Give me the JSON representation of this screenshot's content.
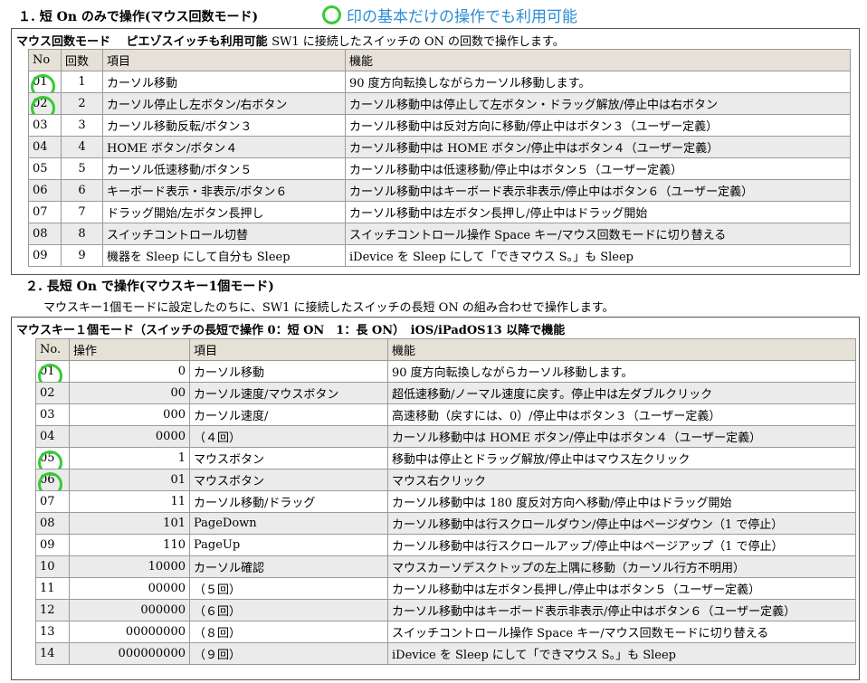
{
  "section1": {
    "title": "１. 短 On のみで操作(マウス回数モード)",
    "note": "印の基本だけの操作でも利用可能",
    "header_bold": "マウス回数モード　 ピエゾスイッチも利用可能",
    "header_plain": "SW1 に接続したスイッチの ON の回数で操作します。",
    "columns": [
      "No",
      "回数",
      "項目",
      "機能"
    ],
    "rows": [
      {
        "no": "01",
        "count": "1",
        "item": "カーソル移動",
        "func": "90 度方向転換しながらカーソル移動します。",
        "highlight": true
      },
      {
        "no": "02",
        "count": "2",
        "item": "カーソル停止し左ボタン/右ボタン",
        "func": "カーソル移動中は停止して左ボタン・ドラッグ解放/停止中は右ボタン",
        "highlight": true
      },
      {
        "no": "03",
        "count": "3",
        "item": "カーソル移動反転/ボタン３",
        "func": "カーソル移動中は反対方向に移動/停止中はボタン３（ユーザー定義）",
        "highlight": false
      },
      {
        "no": "04",
        "count": "4",
        "item": "HOME ボタン/ボタン４",
        "func": "カーソル移動中は HOME ボタン/停止中はボタン４（ユーザー定義）",
        "highlight": false
      },
      {
        "no": "05",
        "count": "5",
        "item": "カーソル低速移動/ボタン５",
        "func": "カーソル移動中は低速移動/停止中はボタン５（ユーザー定義）",
        "highlight": false
      },
      {
        "no": "06",
        "count": "6",
        "item": "キーボード表示・非表示/ボタン６",
        "func": "カーソル移動中はキーボード表示非表示/停止中はボタン６（ユーザー定義）",
        "highlight": false
      },
      {
        "no": "07",
        "count": "7",
        "item": "ドラッグ開始/左ボタン長押し",
        "func": "カーソル移動中は左ボタン長押し/停止中はドラッグ開始",
        "highlight": false
      },
      {
        "no": "08",
        "count": "8",
        "item": "スイッチコントロール切替",
        "func": "スイッチコントロール操作 Space キー/マウス回数モードに切り替える",
        "highlight": false
      },
      {
        "no": "09",
        "count": "9",
        "item": "機器を Sleep にして自分も Sleep",
        "func": "iDevice を Sleep にして「できマウス S。」も Sleep",
        "highlight": false
      }
    ]
  },
  "section2": {
    "title": "２. 長短 On で操作(マウスキー1個モード)",
    "subtitle": "マウスキー1個モードに設定したのちに、SW1 に接続したスイッチの長短 ON の組み合わせで操作します。",
    "header": "マウスキー１個モード（スイッチの長短で操作 0：短 ON　1：長 ON）　iOS/iPadOS13 以降で機能",
    "columns": [
      "No.",
      "操作",
      "項目",
      "機能"
    ],
    "rows": [
      {
        "no": "01",
        "op": "0",
        "item": "カーソル移動",
        "func": "90 度方向転換しながらカーソル移動します。",
        "highlight": true
      },
      {
        "no": "02",
        "op": "00",
        "item": "カーソル速度/マウスボタン",
        "func": "超低速移動/ノーマル速度に戻す。停止中は左ダブルクリック",
        "highlight": false
      },
      {
        "no": "03",
        "op": "000",
        "item": "カーソル速度/",
        "func": "高速移動（戻すには、0）/停止中はボタン３（ユーザー定義）",
        "highlight": false
      },
      {
        "no": "04",
        "op": "0000",
        "item": "（４回）",
        "func": "カーソル移動中は HOME ボタン/停止中はボタン４（ユーザー定義）",
        "highlight": false
      },
      {
        "no": "05",
        "op": "1",
        "item": "マウスボタン",
        "func": "移動中は停止とドラッグ解放/停止中はマウス左クリック",
        "highlight": true
      },
      {
        "no": "06",
        "op": "01",
        "item": "マウスボタン",
        "func": "マウス右クリック",
        "highlight": true
      },
      {
        "no": "07",
        "op": "11",
        "item": "カーソル移動/ドラッグ",
        "func": "カーソル移動中は 180 度反対方向へ移動/停止中はドラッグ開始",
        "highlight": false
      },
      {
        "no": "08",
        "op": "101",
        "item": "PageDown",
        "func": "カーソル移動中は行スクロールダウン/停止中はページダウン（1 で停止）",
        "highlight": false
      },
      {
        "no": "09",
        "op": "110",
        "item": "PageUp",
        "func": "カーソル移動中は行スクロールアップ/停止中はページアップ（1 で停止）",
        "highlight": false
      },
      {
        "no": "10",
        "op": "10000",
        "item": "カーソル確認",
        "func": "マウスカーソデスクトップの左上隅に移動（カーソル行方不明用）",
        "highlight": false
      },
      {
        "no": "11",
        "op": "00000",
        "item": "（５回）",
        "func": "カーソル移動中は左ボタン長押し/停止中はボタン５（ユーザー定義）",
        "highlight": false
      },
      {
        "no": "12",
        "op": "000000",
        "item": "（６回）",
        "func": "カーソル移動中はキーボード表示非表示/停止中はボタン６（ユーザー定義）",
        "highlight": false
      },
      {
        "no": "13",
        "op": "00000000",
        "item": "（８回）",
        "func": "スイッチコントロール操作 Space キー/マウス回数モードに切り替える",
        "highlight": false
      },
      {
        "no": "14",
        "op": "000000000",
        "item": "（９回）",
        "func": "iDevice を Sleep にして「できマウス S。」も Sleep",
        "highlight": false
      }
    ]
  }
}
